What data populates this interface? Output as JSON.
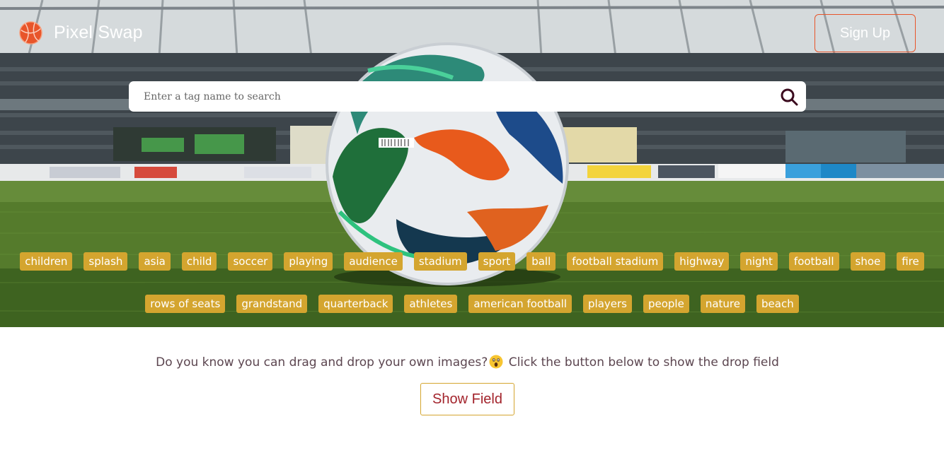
{
  "brand": {
    "name": "Pixel Swap",
    "logo_icon": "globe-icon"
  },
  "header": {
    "signup_label": "Sign Up"
  },
  "search": {
    "placeholder": "Enter a tag name to search",
    "value": "",
    "icon": "search-icon"
  },
  "tags": {
    "row1": [
      "children",
      "splash",
      "asia",
      "child",
      "soccer",
      "playing",
      "audience",
      "stadium",
      "sport",
      "ball",
      "football stadium",
      "highway",
      "night",
      "football",
      "shoe",
      "fire"
    ],
    "row2": [
      "rows of seats",
      "grandstand",
      "quarterback",
      "athletes",
      "american football",
      "players",
      "people",
      "nature",
      "beach"
    ]
  },
  "info": {
    "text_before": "Do you know you can drag and drop your own images?",
    "emoji": "astonished-face-emoji",
    "text_after": " Click the button below to show the drop field"
  },
  "actions": {
    "show_field_label": "Show Field"
  },
  "colors": {
    "tag_bg": "#d4a52f",
    "accent_orange": "#e8552a",
    "button_text": "#a3242c",
    "info_text": "#5c4650"
  }
}
